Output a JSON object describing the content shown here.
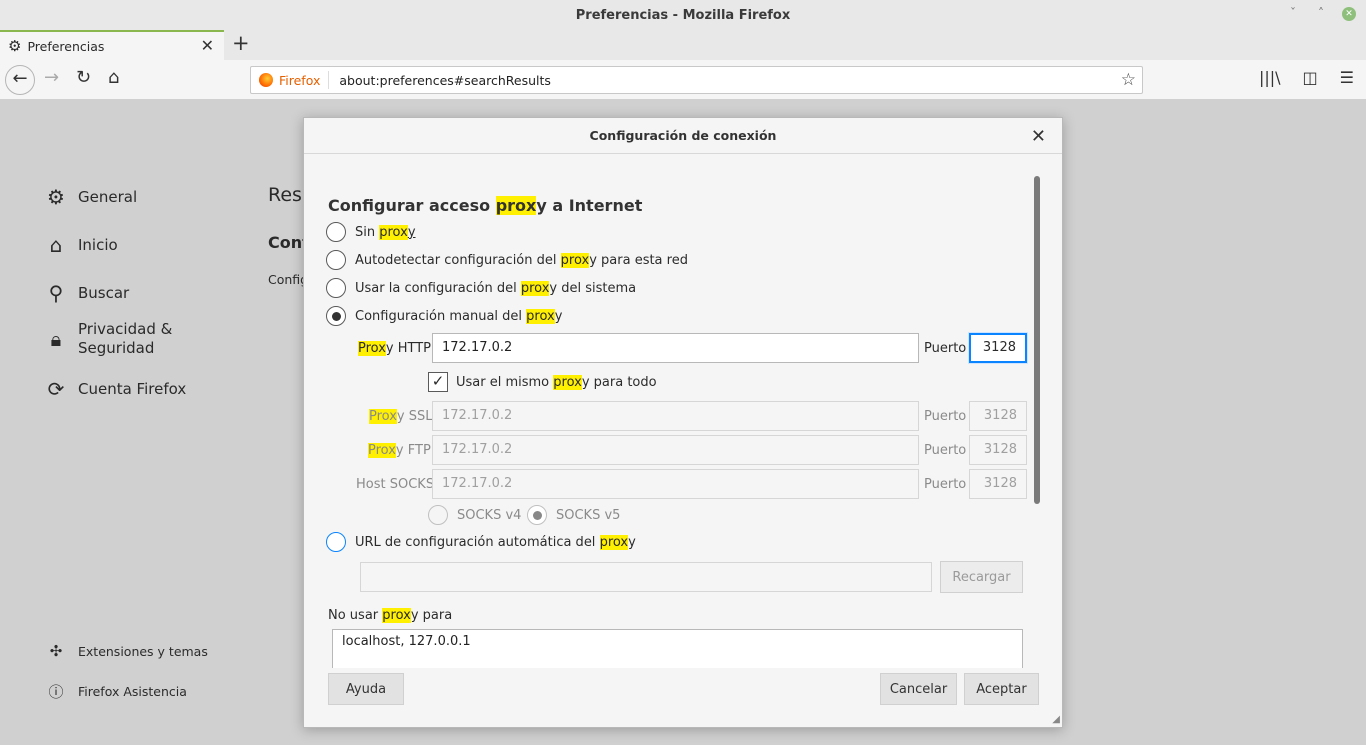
{
  "window": {
    "title": "Preferencias - Mozilla Firefox"
  },
  "tab": {
    "label": "Preferencias"
  },
  "urlbar": {
    "identity": "Firefox",
    "url": "about:preferences#searchResults"
  },
  "sidebar": {
    "items": [
      {
        "label": "General",
        "icon": "gear-icon"
      },
      {
        "label": "Inicio",
        "icon": "home-icon"
      },
      {
        "label": "Buscar",
        "icon": "search-icon"
      },
      {
        "label_line1": "Privacidad &",
        "label_line2": "Seguridad",
        "icon": "lock-icon"
      },
      {
        "label": "Cuenta Firefox",
        "icon": "sync-icon"
      }
    ],
    "bottom": [
      {
        "label": "Extensiones y temas",
        "icon": "puzzle-icon"
      },
      {
        "label": "Firefox Asistencia",
        "icon": "help-icon"
      }
    ]
  },
  "background": {
    "results_title": "Resu",
    "conf_heading": "Conf",
    "config_text": "Config"
  },
  "dialog": {
    "title": "Configuración de conexión",
    "heading": {
      "pre": "Configurar acceso ",
      "hl": "prox",
      "post": "y a Internet"
    },
    "options": {
      "none": {
        "pre": "Sin ",
        "hl": "prox",
        "post": "y"
      },
      "auto": {
        "pre": "Autodetectar configuración del ",
        "hl": "prox",
        "post": "y para esta red"
      },
      "system": {
        "pre": "Usar la configuración del ",
        "hl": "prox",
        "post": "y del sistema"
      },
      "manual": {
        "pre": "Configuración manual del ",
        "hl": "prox",
        "post": "y"
      },
      "pac": {
        "pre": "URL de configuración automática del ",
        "hl": "prox",
        "post": "y"
      }
    },
    "http": {
      "hl": "Prox",
      "post": "y HTTP",
      "value": "172.17.0.2",
      "port_label": "Puerto",
      "port": "3128"
    },
    "same_proxy": {
      "pre": "Usar el mismo ",
      "hl": "prox",
      "post": "y para todo",
      "checked": true
    },
    "ssl": {
      "hl": "Prox",
      "post": "y SSL",
      "value": "172.17.0.2",
      "port_label": "Puerto",
      "port": "3128"
    },
    "ftp": {
      "hl": "Prox",
      "post": "y FTP",
      "value": "172.17.0.2",
      "port_label": "Puerto",
      "port": "3128"
    },
    "socks": {
      "label": "Host SOCKS",
      "value": "172.17.0.2",
      "port_label": "Puerto",
      "port": "3128",
      "v4": "SOCKS v4",
      "v5": "SOCKS v5"
    },
    "pac_url": "",
    "reload": "Recargar",
    "no_proxy": {
      "pre": "No usar ",
      "hl": "prox",
      "post": "y para",
      "value": "localhost, 127.0.0.1"
    },
    "buttons": {
      "help": "Ayuda",
      "cancel": "Cancelar",
      "accept": "Aceptar"
    }
  },
  "colors": {
    "highlight": "#ffef00",
    "focus": "#0a84ff",
    "tab_accent": "#8bb74f"
  }
}
